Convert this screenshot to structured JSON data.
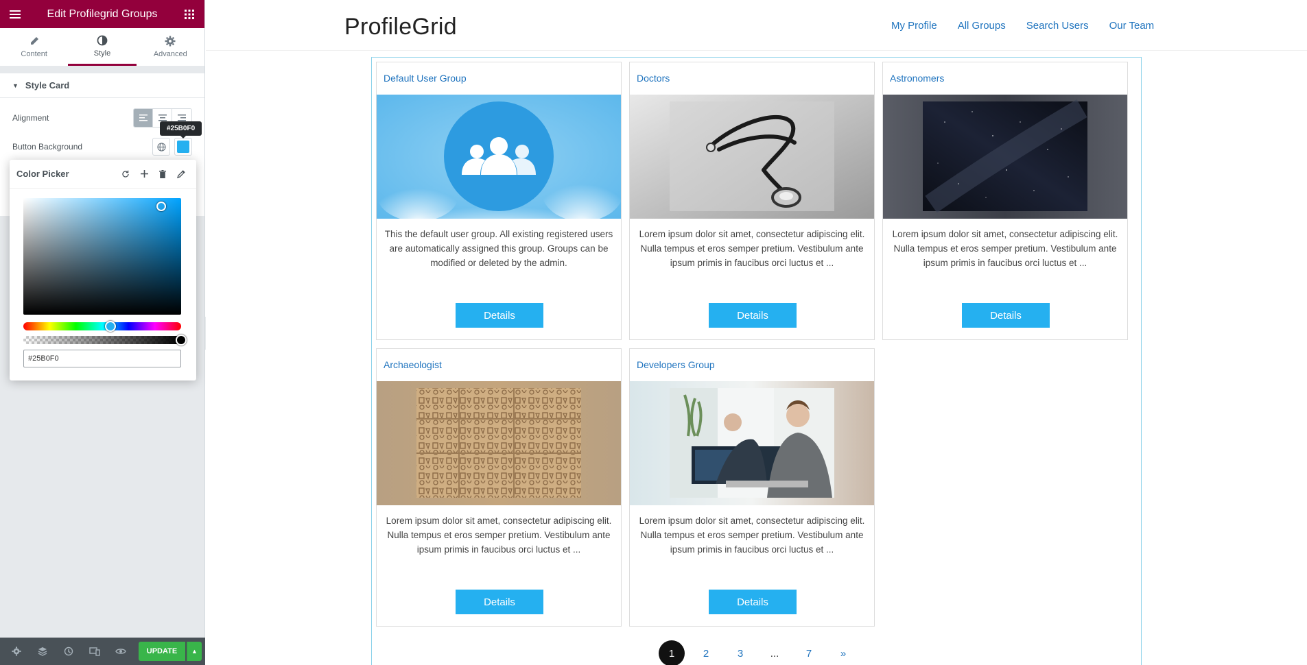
{
  "editor": {
    "title": "Edit Profilegrid Groups",
    "tabs": [
      {
        "label": "Content",
        "icon": "pencil-icon"
      },
      {
        "label": "Style",
        "icon": "half-circle-icon"
      },
      {
        "label": "Advanced",
        "icon": "gear-icon"
      }
    ],
    "active_tab": "Style",
    "section_title": "Style Card",
    "alignment_label": "Alignment",
    "button_background_label": "Button Background",
    "button_background_color": "#25B0F0",
    "tooltip": "#25B0F0",
    "color_picker": {
      "title": "Color Picker",
      "hex_value": "#25B0F0",
      "hue_position": 0.55,
      "alpha": 1
    },
    "footer": {
      "update_label": "UPDATE",
      "icons": [
        "settings-icon",
        "layers-icon",
        "history-icon",
        "responsive-icon",
        "preview-eye-icon"
      ]
    }
  },
  "site": {
    "logo": "ProfileGrid",
    "nav": [
      "My Profile",
      "All Groups",
      "Search Users",
      "Our Team"
    ]
  },
  "groups": [
    {
      "title": "Default User Group",
      "description": "This the default user group. All existing registered users are automatically assigned this group. Groups can be modified or deleted by the admin.",
      "button": "Details"
    },
    {
      "title": "Doctors",
      "description": "Lorem ipsum dolor sit amet, consectetur adipiscing elit. Nulla tempus et eros semper pretium. Vestibulum ante ipsum primis in faucibus orci luctus et ...",
      "button": "Details"
    },
    {
      "title": "Astronomers",
      "description": "Lorem ipsum dolor sit amet, consectetur adipiscing elit. Nulla tempus et eros semper pretium. Vestibulum ante ipsum primis in faucibus orci luctus et ...",
      "button": "Details"
    },
    {
      "title": "Archaeologist",
      "description": "Lorem ipsum dolor sit amet, consectetur adipiscing elit. Nulla tempus et eros semper pretium. Vestibulum ante ipsum primis in faucibus orci luctus et ...",
      "button": "Details"
    },
    {
      "title": "Developers Group",
      "description": "Lorem ipsum dolor sit amet, consectetur adipiscing elit. Nulla tempus et eros semper pretium. Vestibulum ante ipsum primis in faucibus orci luctus et ...",
      "button": "Details"
    }
  ],
  "pagination": {
    "current": "1",
    "pages": [
      "2",
      "3",
      "...",
      "7",
      "»"
    ]
  },
  "colors": {
    "editor_brand": "#93003C",
    "accent": "#25B0F0",
    "link": "#1E73BE",
    "update_green": "#39B54A"
  }
}
